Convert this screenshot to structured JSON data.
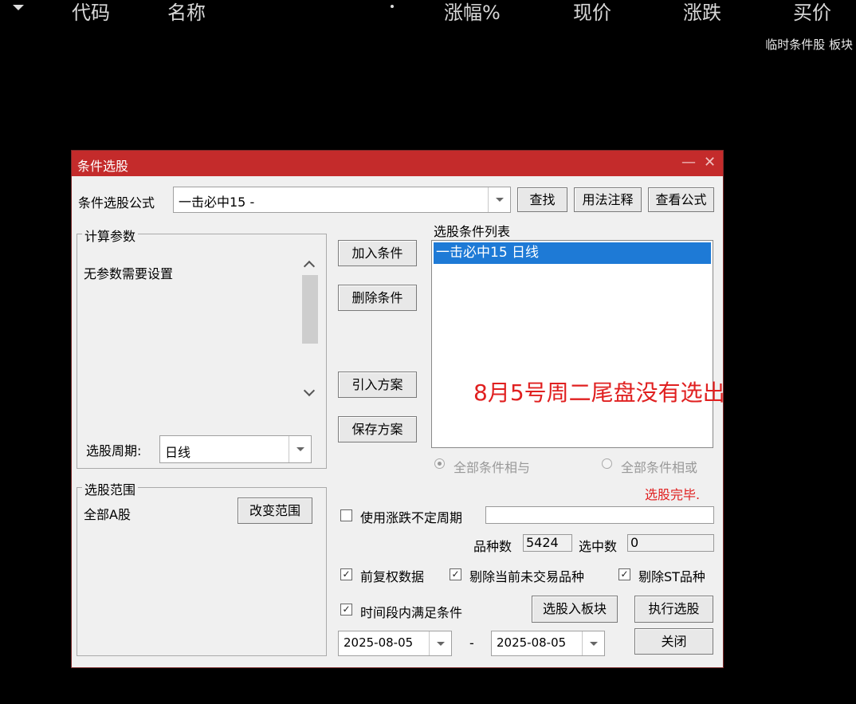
{
  "table_header": {
    "columns": [
      "代码",
      "名称",
      "涨幅%",
      "现价",
      "涨跌",
      "买价"
    ],
    "block_tag": "临时条件股 板块"
  },
  "dialog": {
    "title": "条件选股",
    "formula_label": "条件选股公式",
    "formula_value": "一击必中15  -",
    "buttons": {
      "find": "查找",
      "usage": "用法注释",
      "view_formula": "查看公式"
    },
    "params_group": {
      "title": "计算参数",
      "text": "无参数需要设置"
    },
    "period": {
      "label": "选股周期:",
      "value": "日线"
    },
    "scope_group": {
      "title": "选股范围",
      "value": "全部A股",
      "change_button": "改变范围"
    },
    "actions": {
      "add": "加入条件",
      "delete": "删除条件",
      "import": "引入方案",
      "save": "保存方案"
    },
    "condition_list": {
      "title": "选股条件列表",
      "items": [
        "一击必中15  日线"
      ]
    },
    "annotation": "8月5号周二尾盘没有选出",
    "logic": {
      "and": "全部条件相与",
      "or": "全部条件相或",
      "selected": "and"
    },
    "status": "选股完毕.",
    "variable_period": {
      "label": "使用涨跌不定周期",
      "checked": false,
      "value": ""
    },
    "counts": {
      "total_label": "品种数",
      "total": "5424",
      "selected_label": "选中数",
      "selected": "0"
    },
    "options": [
      {
        "label": "前复权数据",
        "checked": true
      },
      {
        "label": "剔除当前未交易品种",
        "checked": true
      },
      {
        "label": "剔除ST品种",
        "checked": true
      },
      {
        "label": "时间段内满足条件",
        "checked": true
      }
    ],
    "dates": {
      "start": "2025-08-05",
      "separator": "-",
      "end": "2025-08-05"
    },
    "bottom_buttons": {
      "to_block": "选股入板块",
      "execute": "执行选股",
      "close": "关闭"
    }
  }
}
